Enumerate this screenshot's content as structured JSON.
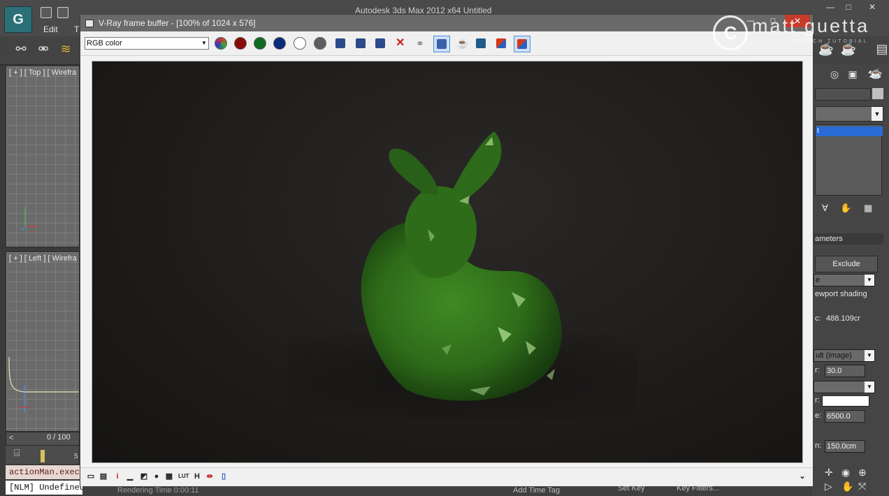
{
  "app": {
    "title": "Autodesk 3ds Max  2012 x64      Untitled",
    "logo": "3ds-max-logo",
    "menu": [
      "Edit",
      "T"
    ],
    "window_controls": [
      "—",
      "□",
      "✕"
    ]
  },
  "viewports": {
    "top_label": "[ + ] [ Top ] [ Wirefra",
    "left_label": "[ + ] [ Left ] [ Wirefra"
  },
  "timeline": {
    "frame": "0 / 100",
    "arrow": "<",
    "tick": "5"
  },
  "maxscript": {
    "input": "actionMan.exec",
    "output": "[NLM] Undefined Lay"
  },
  "status": {
    "rendering_time": "Rendering Time  0:00:11",
    "add_time_tag": "Add Time Tag",
    "set_key": "Set Key",
    "key_filters": "Key Filters..."
  },
  "command_panel": {
    "rollout": "ameters",
    "exclude_button": "Exclude",
    "shading_select": "e",
    "viewport_shading": "ewport shading",
    "value_1": "488.109cr",
    "value_1_prefix": "c:",
    "mode_select": "ult (image)",
    "spinner_1": "30.0",
    "spinner_1_prefix": "r:",
    "spinner_2": "6500.0",
    "spinner_2_prefix": "e:",
    "spinner_3": "150.0cm",
    "spinner_3_prefix": "n:",
    "color_prefix": "r:",
    "list_selected": "t"
  },
  "vfb": {
    "title": "V-Ray frame buffer - [100% of 1024 x 576]",
    "channel": "RGB color",
    "toolbar_buttons": [
      {
        "name": "display-color-channels-icon",
        "color": "#5a6e8c"
      },
      {
        "name": "red-channel-icon",
        "color": "#8a0a0a"
      },
      {
        "name": "green-channel-icon",
        "color": "#0f6b1f"
      },
      {
        "name": "blue-channel-icon",
        "color": "#0a2a7a"
      },
      {
        "name": "alpha-channel-icon",
        "color": "#ffffff"
      },
      {
        "name": "monochrome-icon",
        "color": "#5e5e5e"
      },
      {
        "name": "save-image-icon",
        "color": "#2b4a8a"
      },
      {
        "name": "save-all-icon",
        "color": "#2b4a8a"
      },
      {
        "name": "load-image-icon",
        "color": "#2b4a8a"
      },
      {
        "name": "clear-image-icon",
        "color": "#cc1e1e"
      },
      {
        "name": "duplicate-to-max-vfb-icon",
        "color": "#777777"
      },
      {
        "name": "track-mouse-icon",
        "color": "#3b5fa8"
      },
      {
        "name": "render-last-icon",
        "color": "#333333"
      },
      {
        "name": "region-render-icon",
        "color": "#1f5a8a"
      },
      {
        "name": "ab-compare-icon",
        "color": "#d43a1a"
      },
      {
        "name": "ab-compare-active-icon",
        "color": "#d43a1a"
      }
    ],
    "bottom_labels": {
      "info": "i",
      "h": "H",
      "lut": "LUT"
    }
  },
  "watermark": {
    "name": "matt guetta",
    "sub": "FRENCH  TUTORIAL"
  },
  "colors": {
    "accent": "#2a6bd6",
    "close_red": "#c63b2c",
    "bunny_green": "#2f6f1a"
  }
}
